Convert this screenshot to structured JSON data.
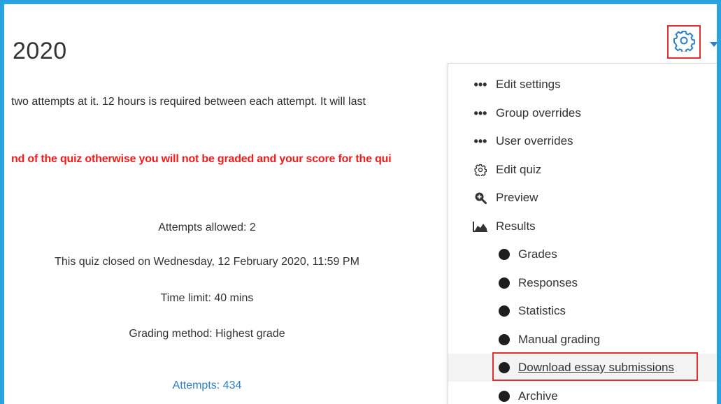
{
  "page": {
    "title": "2020",
    "intro": "two attempts at it. 12 hours is required between each attempt. It will last",
    "warning": "nd of the quiz otherwise you will not be graded and your score for the qui"
  },
  "quiz_info": {
    "attempts_allowed": "Attempts allowed: 2",
    "closed": "This quiz closed on Wednesday, 12 February 2020, 11:59 PM",
    "time_limit": "Time limit: 40 mins",
    "grading_method": "Grading method: Highest grade",
    "attempts_link": "Attempts: 434"
  },
  "menu": {
    "items": [
      {
        "label": "Edit settings",
        "icon": "dots-icon"
      },
      {
        "label": "Group overrides",
        "icon": "dots-icon"
      },
      {
        "label": "User overrides",
        "icon": "dots-icon"
      },
      {
        "label": "Edit quiz",
        "icon": "gear-icon"
      },
      {
        "label": "Preview",
        "icon": "zoom-in-icon"
      },
      {
        "label": "Results",
        "icon": "area-chart-icon"
      }
    ],
    "results_sub": [
      {
        "label": "Grades"
      },
      {
        "label": "Responses"
      },
      {
        "label": "Statistics"
      },
      {
        "label": "Manual grading"
      },
      {
        "label": "Download essay submissions"
      },
      {
        "label": "Archive"
      }
    ]
  },
  "colors": {
    "frame": "#29a3e0",
    "highlight_box": "#e23030",
    "warning_text": "#ee1c1c",
    "link": "#2f7fc4"
  }
}
